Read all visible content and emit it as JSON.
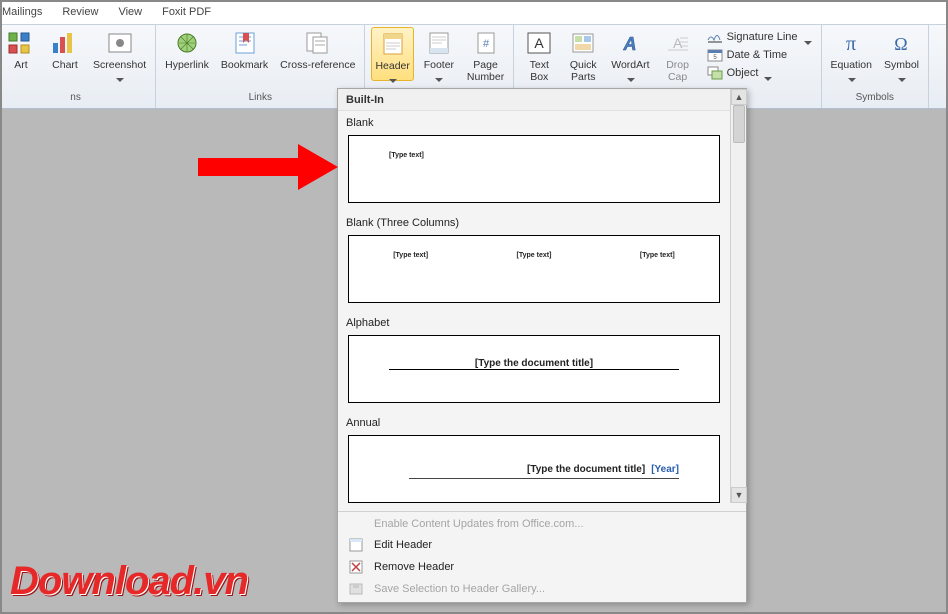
{
  "tabs": {
    "mailings": "Mailings",
    "review": "Review",
    "view": "View",
    "foxit": "Foxit PDF"
  },
  "ribbon": {
    "illustrations": {
      "art": "Art",
      "chart": "Chart",
      "screenshot": "Screenshot",
      "group": "ns"
    },
    "links": {
      "hyperlink": "Hyperlink",
      "bookmark": "Bookmark",
      "crossref": "Cross-reference",
      "group": "Links"
    },
    "headerfooter": {
      "header": "Header",
      "footer": "Footer",
      "pagenumber": "Page\nNumber"
    },
    "text": {
      "textbox": "Text\nBox",
      "quickparts": "Quick\nParts",
      "wordart": "WordArt",
      "dropcap": "Drop\nCap",
      "sigline": "Signature Line",
      "datetime": "Date & Time",
      "object": "Object"
    },
    "symbols": {
      "equation": "Equation",
      "symbol": "Symbol",
      "group": "Symbols"
    }
  },
  "gallery": {
    "section": "Built-In",
    "blank": "Blank",
    "blank_ph": "[Type text]",
    "three": "Blank (Three Columns)",
    "three_ph": "[Type text]",
    "alphabet": "Alphabet",
    "alphabet_ph": "[Type the document title]",
    "annual": "Annual",
    "annual_title": "[Type the document title]",
    "annual_year": "[Year]"
  },
  "menu": {
    "enable": "Enable Content Updates from Office.com...",
    "edit": "Edit Header",
    "remove": "Remove Header",
    "save": "Save Selection to Header Gallery..."
  },
  "watermark": "Download.vn"
}
